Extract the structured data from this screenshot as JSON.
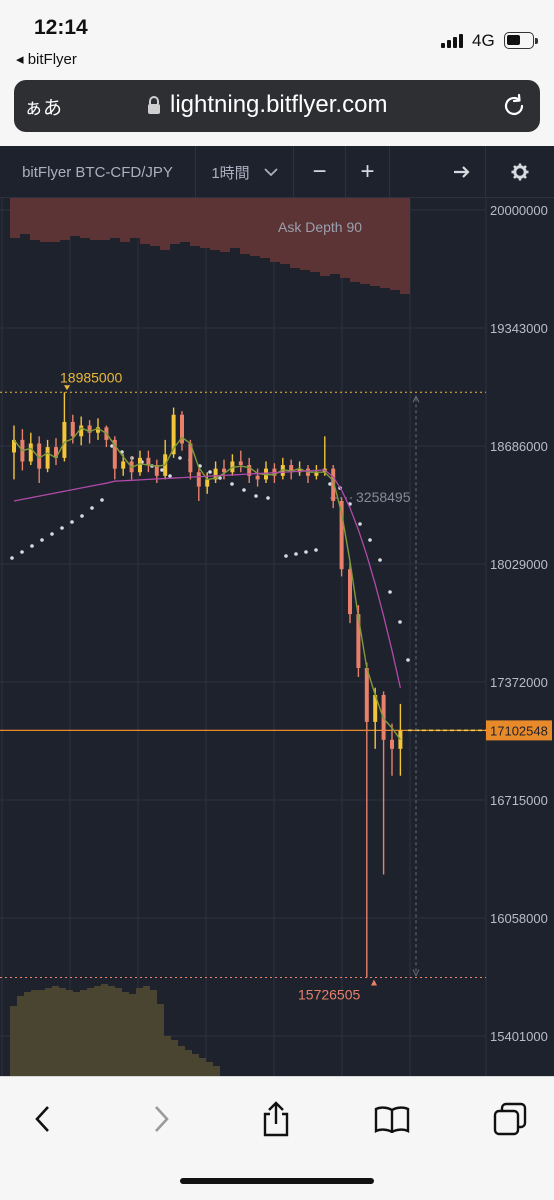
{
  "status": {
    "time": "12:14",
    "back_app": "◂ bitFlyer",
    "network": "4G"
  },
  "browser": {
    "aa_label": "ぁあ",
    "url": "lightning.bitflyer.com"
  },
  "toolbar": {
    "symbol": "bitFlyer BTC-CFD/JPY",
    "interval": "1時間",
    "zoom_out": "−",
    "zoom_in": "+"
  },
  "chart_data": {
    "type": "candlestick",
    "y_axis_ticks": [
      "20000000",
      "19343000",
      "18686000",
      "18029000",
      "17372000",
      "16715000",
      "16058000",
      "15401000"
    ],
    "ylim": [
      15300000,
      20100000
    ],
    "current_price": "17102548",
    "high_label": "18985000",
    "low_label": "15726505",
    "ask_depth_label": "Ask Depth 90",
    "depth_annotation": "3258495",
    "candles": [
      [
        18650000,
        18720000,
        18500000,
        18800000
      ],
      [
        18720000,
        18600000,
        18550000,
        18780000
      ],
      [
        18600000,
        18700000,
        18580000,
        18760000
      ],
      [
        18700000,
        18560000,
        18480000,
        18740000
      ],
      [
        18560000,
        18680000,
        18540000,
        18720000
      ],
      [
        18680000,
        18620000,
        18580000,
        18730000
      ],
      [
        18620000,
        18820000,
        18600000,
        18985000
      ],
      [
        18820000,
        18740000,
        18700000,
        18860000
      ],
      [
        18740000,
        18800000,
        18690000,
        18850000
      ],
      [
        18800000,
        18760000,
        18700000,
        18830000
      ],
      [
        18760000,
        18790000,
        18720000,
        18840000
      ],
      [
        18790000,
        18720000,
        18680000,
        18800000
      ],
      [
        18720000,
        18560000,
        18500000,
        18740000
      ],
      [
        18560000,
        18600000,
        18520000,
        18640000
      ],
      [
        18600000,
        18540000,
        18500000,
        18630000
      ],
      [
        18540000,
        18620000,
        18520000,
        18660000
      ],
      [
        18620000,
        18580000,
        18540000,
        18660000
      ],
      [
        18580000,
        18520000,
        18480000,
        18610000
      ],
      [
        18520000,
        18640000,
        18500000,
        18720000
      ],
      [
        18640000,
        18860000,
        18620000,
        18900000
      ],
      [
        18860000,
        18700000,
        18660000,
        18880000
      ],
      [
        18700000,
        18540000,
        18500000,
        18720000
      ],
      [
        18540000,
        18460000,
        18380000,
        18560000
      ],
      [
        18460000,
        18500000,
        18420000,
        18540000
      ],
      [
        18500000,
        18560000,
        18480000,
        18600000
      ],
      [
        18560000,
        18540000,
        18500000,
        18610000
      ],
      [
        18540000,
        18600000,
        18520000,
        18640000
      ],
      [
        18600000,
        18580000,
        18540000,
        18660000
      ],
      [
        18580000,
        18520000,
        18480000,
        18620000
      ],
      [
        18520000,
        18500000,
        18460000,
        18560000
      ],
      [
        18500000,
        18560000,
        18480000,
        18600000
      ],
      [
        18560000,
        18520000,
        18480000,
        18590000
      ],
      [
        18520000,
        18580000,
        18500000,
        18620000
      ],
      [
        18580000,
        18540000,
        18500000,
        18610000
      ],
      [
        18540000,
        18560000,
        18520000,
        18600000
      ],
      [
        18560000,
        18520000,
        18480000,
        18580000
      ],
      [
        18520000,
        18540000,
        18500000,
        18580000
      ],
      [
        18540000,
        18560000,
        18520000,
        18740000
      ],
      [
        18560000,
        18380000,
        18340000,
        18580000
      ],
      [
        18380000,
        18000000,
        17960000,
        18400000
      ],
      [
        18000000,
        17750000,
        17700000,
        18040000
      ],
      [
        17750000,
        17450000,
        17400000,
        17800000
      ],
      [
        17450000,
        17150000,
        15726505,
        17480000
      ],
      [
        17150000,
        17300000,
        17000000,
        17340000
      ],
      [
        17300000,
        17050000,
        16300000,
        17320000
      ],
      [
        17050000,
        17000000,
        16850000,
        17140000
      ],
      [
        17000000,
        17102548,
        16850000,
        17250000
      ]
    ]
  }
}
